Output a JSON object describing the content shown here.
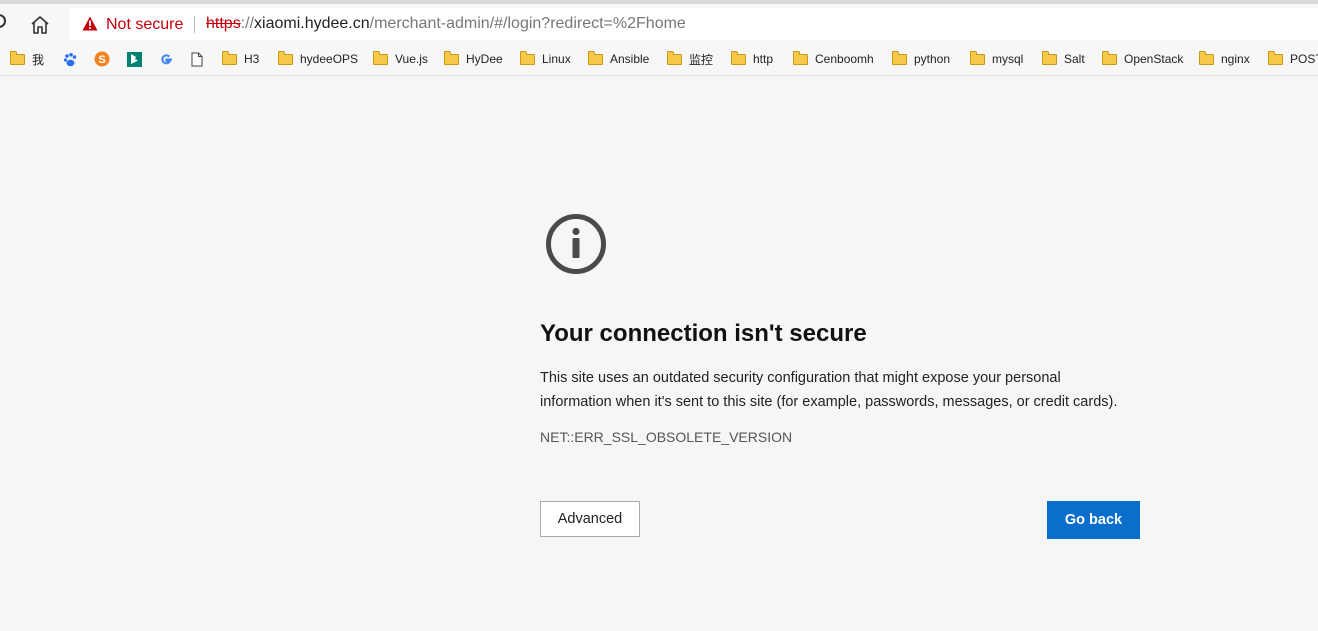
{
  "browser": {
    "security_label": "Not secure",
    "url": {
      "scheme": "https",
      "sep": "://",
      "host": "xiaomi.hydee.cn",
      "path": "/merchant-admin/#/login?redirect=%2Fhome"
    }
  },
  "bookmarks": [
    {
      "label": "我",
      "icon": "folder-icon"
    },
    {
      "label": "",
      "icon": "baidu-icon"
    },
    {
      "label": "",
      "icon": "sogou-icon"
    },
    {
      "label": "",
      "icon": "bing-icon"
    },
    {
      "label": "",
      "icon": "google-icon"
    },
    {
      "label": "",
      "icon": "page-icon"
    },
    {
      "label": "H3",
      "icon": "folder-icon"
    },
    {
      "label": "hydeeOPS",
      "icon": "folder-icon"
    },
    {
      "label": "Vue.js",
      "icon": "folder-icon"
    },
    {
      "label": "HyDee",
      "icon": "folder-icon"
    },
    {
      "label": "Linux",
      "icon": "folder-icon"
    },
    {
      "label": "Ansible",
      "icon": "folder-icon"
    },
    {
      "label": "监控",
      "icon": "folder-icon"
    },
    {
      "label": "http",
      "icon": "folder-icon"
    },
    {
      "label": "Cenboomh",
      "icon": "folder-icon"
    },
    {
      "label": "python",
      "icon": "folder-icon"
    },
    {
      "label": "mysql",
      "icon": "folder-icon"
    },
    {
      "label": "Salt",
      "icon": "folder-icon"
    },
    {
      "label": "OpenStack",
      "icon": "folder-icon"
    },
    {
      "label": "nginx",
      "icon": "folder-icon"
    },
    {
      "label": "POST",
      "icon": "folder-icon"
    }
  ],
  "error_page": {
    "heading": "Your connection isn't secure",
    "description_line1": "This site uses an outdated security configuration that might expose your personal",
    "description_line2": "information when it's sent to this site (for example, passwords, messages, or credit cards).",
    "error_code": "NET::ERR_SSL_OBSOLETE_VERSION",
    "advanced_label": "Advanced",
    "go_back_label": "Go back"
  },
  "colors": {
    "accent": "#0a6fcb",
    "warning": "#c5000b",
    "folder": "#f7c948"
  }
}
